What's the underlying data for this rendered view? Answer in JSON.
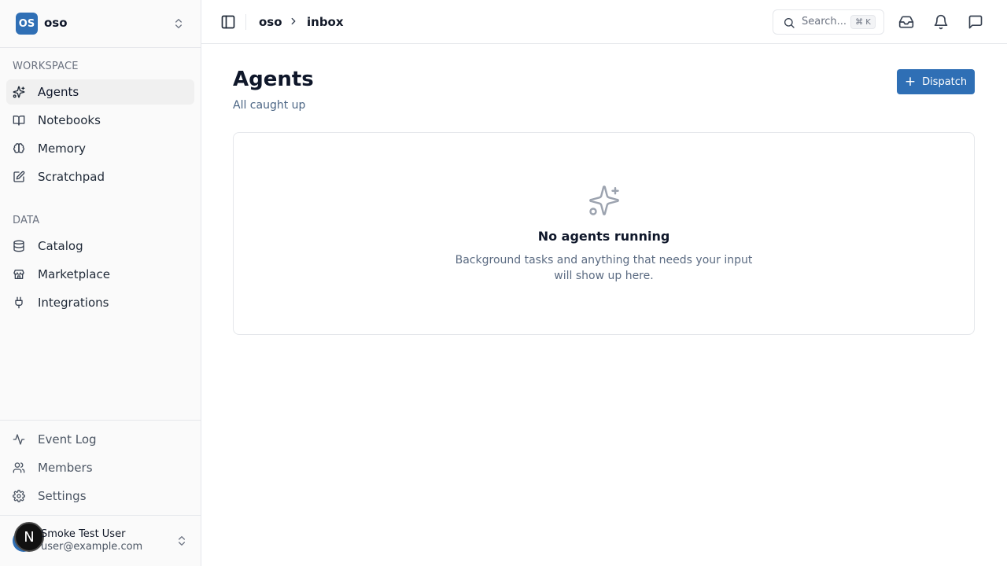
{
  "workspace": {
    "badge": "OS",
    "name": "oso"
  },
  "sidebar": {
    "workspace_label": "WORKSPACE",
    "workspace_items": [
      {
        "label": "Agents",
        "icon": "sparkles-icon",
        "active": true
      },
      {
        "label": "Notebooks",
        "icon": "book-open-icon"
      },
      {
        "label": "Memory",
        "icon": "brain-icon"
      },
      {
        "label": "Scratchpad",
        "icon": "edit-icon"
      }
    ],
    "data_label": "DATA",
    "data_items": [
      {
        "label": "Catalog",
        "icon": "database-icon"
      },
      {
        "label": "Marketplace",
        "icon": "store-icon"
      },
      {
        "label": "Integrations",
        "icon": "plug-icon"
      }
    ],
    "bottom_items": [
      {
        "label": "Event Log",
        "icon": "activity-icon"
      },
      {
        "label": "Members",
        "icon": "users-icon"
      },
      {
        "label": "Settings",
        "icon": "gear-icon"
      }
    ],
    "user": {
      "name": "Smoke Test User",
      "email": "user@example.com",
      "badge": "N"
    }
  },
  "topbar": {
    "breadcrumb": [
      "oso",
      "inbox"
    ],
    "search_placeholder": "Search...",
    "search_shortcut": "⌘ K"
  },
  "main": {
    "title": "Agents",
    "subtitle": "All caught up",
    "dispatch_label": "Dispatch",
    "empty": {
      "title": "No agents running",
      "description": "Background tasks and anything that needs your input will show up here."
    }
  },
  "colors": {
    "accent": "#2f6fb5",
    "sidebar_bg": "#fafafa",
    "border": "#e5e7eb"
  }
}
